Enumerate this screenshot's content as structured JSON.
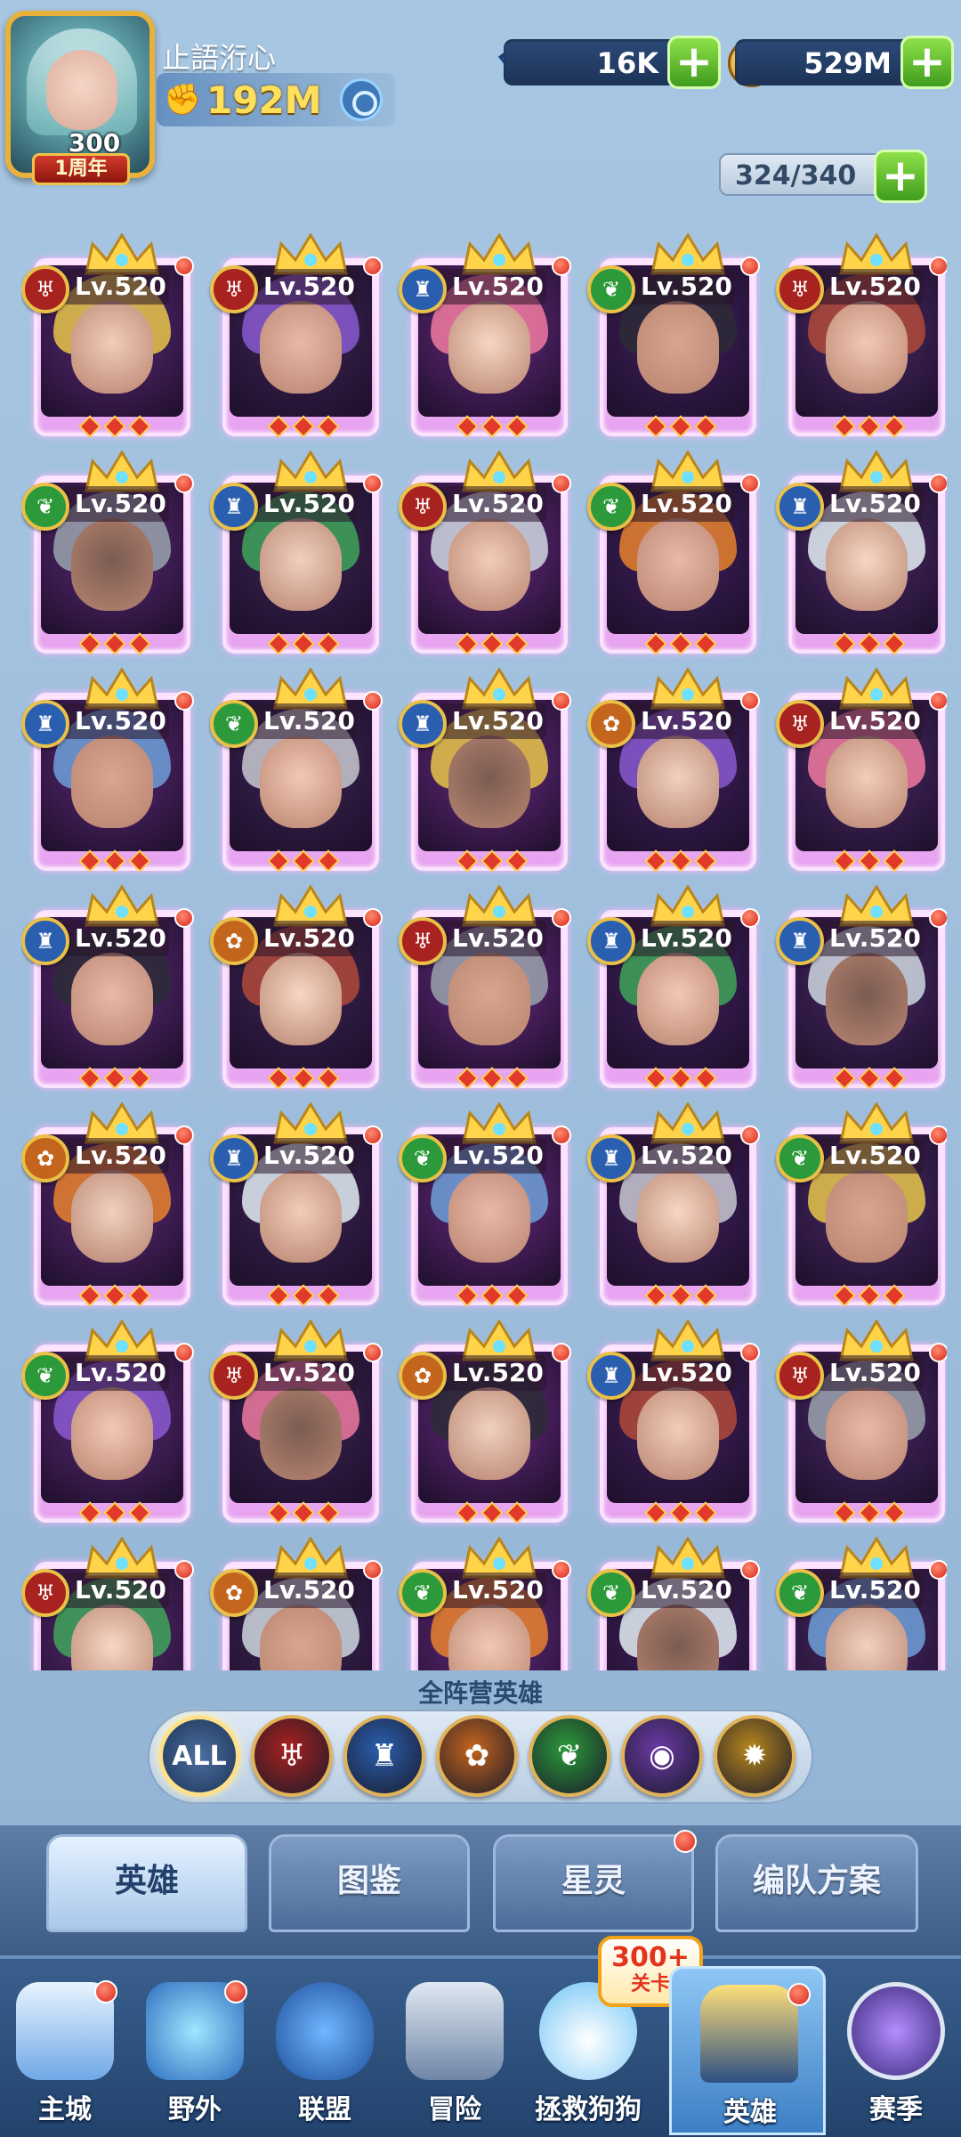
{
  "player": {
    "name": "止語洐心",
    "level": "300",
    "badge": "1周年",
    "power": "192M"
  },
  "resources": {
    "gems": "16K",
    "gold": "529M",
    "capacity": "324/340"
  },
  "heroes": [
    {
      "level": "Lv.520",
      "faction": "red"
    },
    {
      "level": "Lv.520",
      "faction": "red"
    },
    {
      "level": "Lv.520",
      "faction": "blue"
    },
    {
      "level": "Lv.520",
      "faction": "green"
    },
    {
      "level": "Lv.520",
      "faction": "red"
    },
    {
      "level": "Lv.520",
      "faction": "green"
    },
    {
      "level": "Lv.520",
      "faction": "blue"
    },
    {
      "level": "Lv.520",
      "faction": "red"
    },
    {
      "level": "Lv.520",
      "faction": "green"
    },
    {
      "level": "Lv.520",
      "faction": "blue"
    },
    {
      "level": "Lv.520",
      "faction": "blue"
    },
    {
      "level": "Lv.520",
      "faction": "green"
    },
    {
      "level": "Lv.520",
      "faction": "blue"
    },
    {
      "level": "Lv.520",
      "faction": "orange"
    },
    {
      "level": "Lv.520",
      "faction": "red"
    },
    {
      "level": "Lv.520",
      "faction": "blue"
    },
    {
      "level": "Lv.520",
      "faction": "orange"
    },
    {
      "level": "Lv.520",
      "faction": "red"
    },
    {
      "level": "Lv.520",
      "faction": "blue"
    },
    {
      "level": "Lv.520",
      "faction": "blue"
    },
    {
      "level": "Lv.520",
      "faction": "orange"
    },
    {
      "level": "Lv.520",
      "faction": "blue"
    },
    {
      "level": "Lv.520",
      "faction": "green"
    },
    {
      "level": "Lv.520",
      "faction": "blue"
    },
    {
      "level": "Lv.520",
      "faction": "green"
    },
    {
      "level": "Lv.520",
      "faction": "green"
    },
    {
      "level": "Lv.520",
      "faction": "red"
    },
    {
      "level": "Lv.520",
      "faction": "orange"
    },
    {
      "level": "Lv.520",
      "faction": "blue"
    },
    {
      "level": "Lv.520",
      "faction": "red"
    },
    {
      "level": "Lv.520",
      "faction": "red"
    },
    {
      "level": "Lv.520",
      "faction": "orange"
    },
    {
      "level": "Lv.520",
      "faction": "green"
    },
    {
      "level": "Lv.520",
      "faction": "green"
    },
    {
      "level": "Lv.520",
      "faction": "green"
    }
  ],
  "filter": {
    "title": "全阵营英雄",
    "all_label": "ALL",
    "factions": [
      "red-bat-icon",
      "blue-tower-icon",
      "orange-paw-icon",
      "green-leaf-icon",
      "purple-orb-icon",
      "gold-sun-icon"
    ]
  },
  "subtabs": [
    "英雄",
    "图鉴",
    "星灵",
    "编队方案"
  ],
  "nav": [
    "主城",
    "野外",
    "联盟",
    "冒险",
    "拯救狗狗",
    "英雄",
    "赛季"
  ],
  "promo": {
    "line1": "300+",
    "line2": "关卡"
  },
  "colors": {
    "red": "#a8221f",
    "blue": "#2a5fb0",
    "green": "#2c9a3a",
    "orange": "#c4651d",
    "purple": "#6b3aa6",
    "gold": "#b8871d"
  }
}
